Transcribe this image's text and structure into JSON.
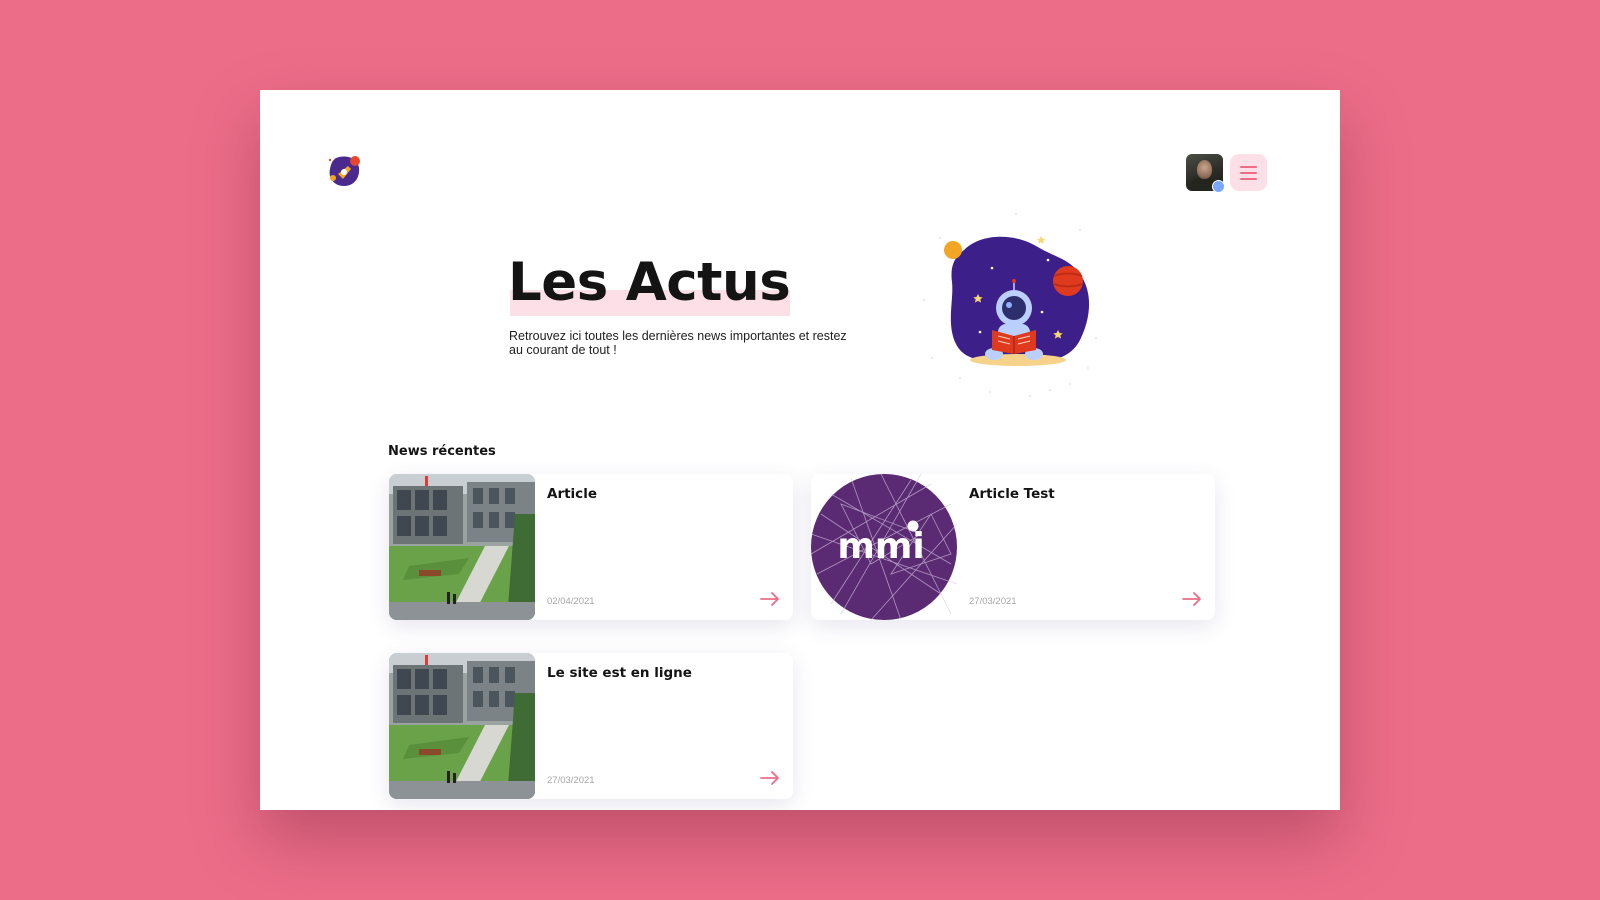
{
  "hero": {
    "title": "Les Actus",
    "subtitle": "Retrouvez ici toutes les dernières news importantes et restez au courant de tout !"
  },
  "news": {
    "section_title": "News récentes",
    "articles": [
      {
        "title": "Article",
        "date": "02/04/2021",
        "thumbnail": "campus-building"
      },
      {
        "title": "Article Test",
        "date": "27/03/2021",
        "thumbnail": "mmi-logo",
        "thumbnail_text": "mmi"
      },
      {
        "title": "Le site est en ligne",
        "date": "27/03/2021",
        "thumbnail": "campus-building"
      }
    ]
  },
  "header": {
    "logo_icon": "planet-rocket-logo",
    "avatar": "user-avatar-photo",
    "menu_icon": "hamburger-menu-icon"
  },
  "colors": {
    "background": "#ec6d88",
    "accent_pink": "#ec6d88",
    "highlight_pink": "#fde0e7",
    "mmi_purple": "#5a2a73",
    "illustration_purple": "#3d1f8a",
    "online_blue": "#7aa7ff"
  }
}
